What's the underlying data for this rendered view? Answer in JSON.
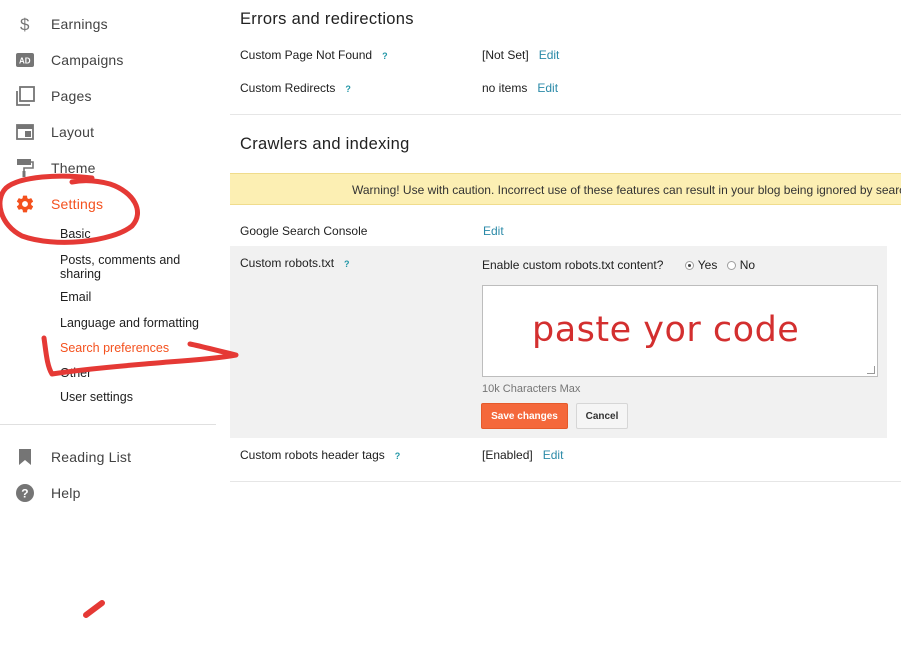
{
  "sidebar": {
    "nav": [
      {
        "label": "Earnings",
        "icon": "dollar-icon"
      },
      {
        "label": "Campaigns",
        "icon": "ad-icon"
      },
      {
        "label": "Pages",
        "icon": "pages-icon"
      },
      {
        "label": "Layout",
        "icon": "layout-icon"
      },
      {
        "label": "Theme",
        "icon": "paint-roller-icon"
      },
      {
        "label": "Settings",
        "icon": "gear-icon"
      }
    ],
    "sub": [
      "Basic",
      "Posts, comments and",
      "sharing",
      "Email",
      "Language and formatting",
      "Search preferences",
      "Other",
      "User settings"
    ],
    "bottom": [
      {
        "label": "Reading List",
        "icon": "bookmark-icon"
      },
      {
        "label": "Help",
        "icon": "help-icon"
      }
    ]
  },
  "errors": {
    "title": "Errors and redirections",
    "not_found_label": "Custom Page Not Found",
    "not_found_value": "[Not Set]",
    "redirects_label": "Custom Redirects",
    "redirects_value": "no items"
  },
  "crawlers": {
    "title": "Crawlers and indexing",
    "warning": "Warning! Use with caution. Incorrect use of these features can result in your blog being ignored by search",
    "console_label": "Google Search Console",
    "robots_label": "Custom robots.txt",
    "enable_label": "Enable custom robots.txt content?",
    "yes": "Yes",
    "no": "No",
    "max_hint": "10k Characters Max",
    "save": "Save changes",
    "cancel": "Cancel",
    "header_tags_label": "Custom robots header tags",
    "header_tags_value": "[Enabled]"
  },
  "common": {
    "edit": "Edit",
    "help": "?"
  },
  "annotation": {
    "text": "paste yor code",
    "color": "#d32f2f"
  },
  "colors": {
    "accent": "#f4511e",
    "link": "#2b8aa8",
    "warning_bg": "#fcefb3"
  }
}
